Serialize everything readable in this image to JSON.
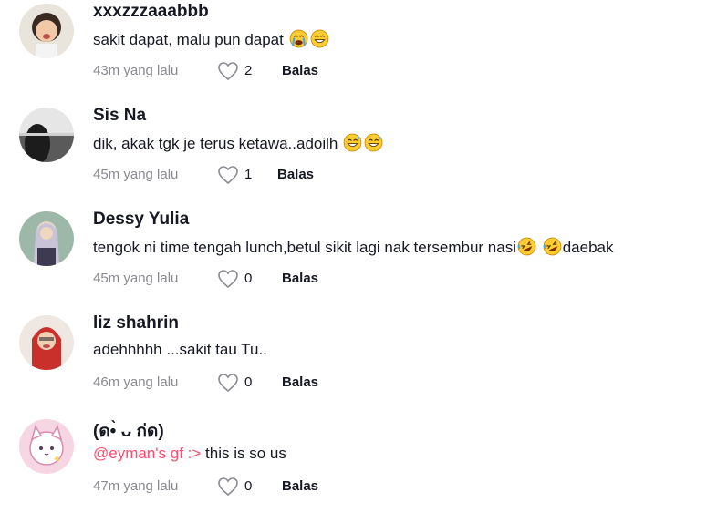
{
  "comments": [
    {
      "username": "xxxzzzaaabbb",
      "text": "sakit dapat, malu pun dapat",
      "emojis": [
        "crying-face-emoji",
        "grinning-sweat-emoji"
      ],
      "time": "43m yang lalu",
      "likes": "2",
      "reply_label": "Balas"
    },
    {
      "username": "Sis Na",
      "text": "dik, akak tgk je terus ketawa..adoilh",
      "emojis": [
        "grinning-sweat-emoji",
        "grinning-sweat-emoji"
      ],
      "time": "45m yang lalu",
      "likes": "1",
      "reply_label": "Balas"
    },
    {
      "username": "Dessy Yulia",
      "text_before": "tengok ni time tengah lunch,betul sikit lagi nak tersembur nasi",
      "emojis": [
        "rolling-laughing-emoji",
        "rolling-laughing-emoji"
      ],
      "text_after": "daebak",
      "time": "45m yang lalu",
      "likes": "0",
      "reply_label": "Balas"
    },
    {
      "username": "liz shahrin",
      "text": "adehhhhh ...sakit tau Tu..",
      "time": "46m yang lalu",
      "likes": "0",
      "reply_label": "Balas"
    },
    {
      "username": "(ด•̀ ᴗ ก่ด)",
      "mention": "@eyman's gf :>",
      "text": " this is so us",
      "time": "47m yang lalu",
      "likes": "0",
      "reply_label": "Balas"
    }
  ],
  "colors": {
    "text": "#161823",
    "muted": "#8a8b91",
    "mention": "#fe2c55"
  }
}
